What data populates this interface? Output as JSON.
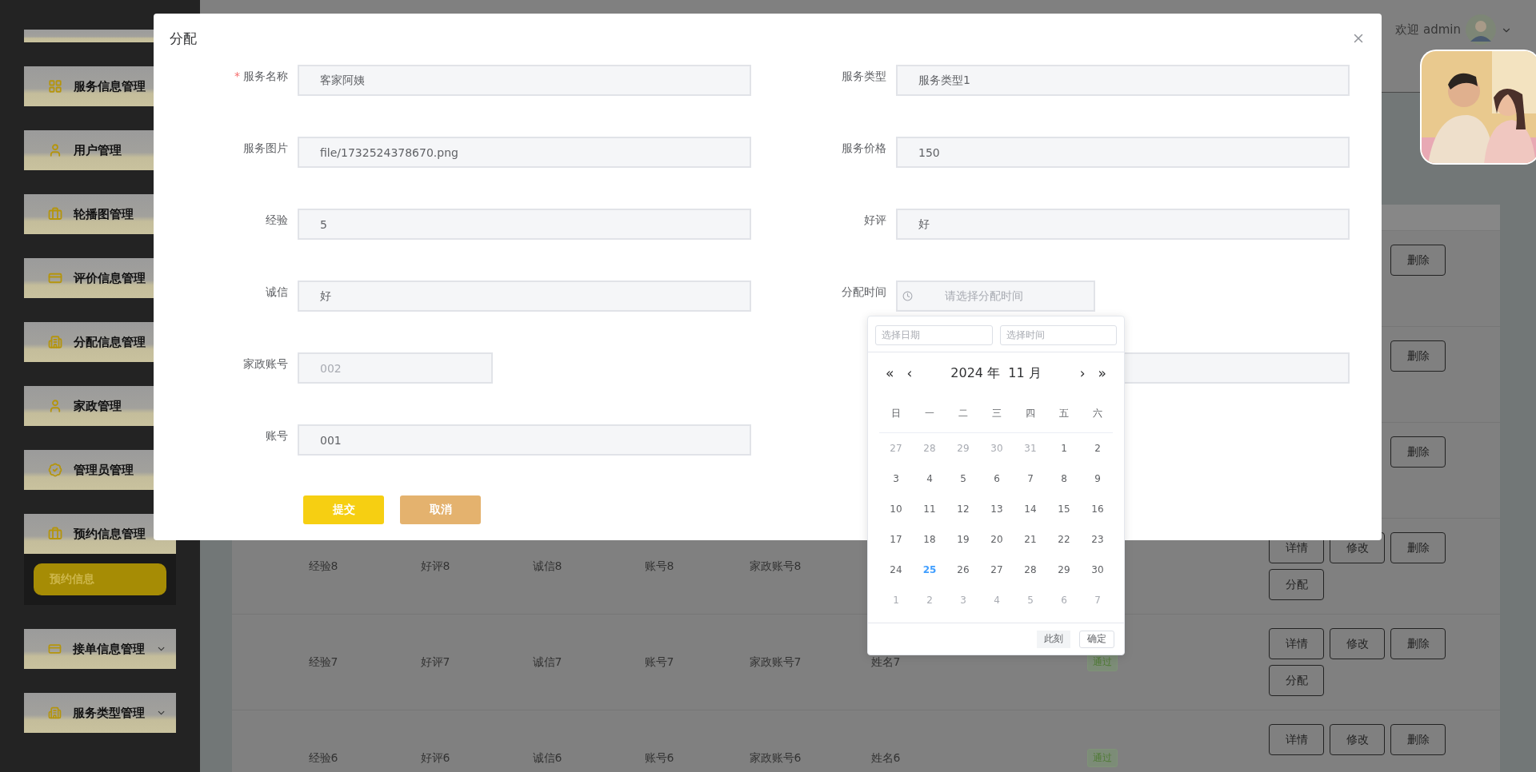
{
  "sidebar": {
    "items": [
      {
        "kind": "stub"
      },
      {
        "label": "服务信息管理",
        "kind": "page"
      },
      {
        "label": "用户管理",
        "kind": "page"
      },
      {
        "label": "轮播图管理",
        "kind": "page"
      },
      {
        "label": "评价信息管理",
        "kind": "page"
      },
      {
        "label": "分配信息管理",
        "kind": "page"
      },
      {
        "label": "家政管理",
        "kind": "page"
      },
      {
        "label": "管理员管理",
        "kind": "page"
      },
      {
        "label": "预约信息管理",
        "kind": "open_menu",
        "children": [
          {
            "label": "预约信息",
            "selected": true
          }
        ]
      },
      {
        "label": "接单信息管理",
        "kind": "menu"
      },
      {
        "label": "服务类型管理",
        "kind": "menu"
      }
    ]
  },
  "header": {
    "welcome": "欢迎 admin"
  },
  "table": {
    "rows": [
      {
        "actions": [
          {
            "label": "删除",
            "kind": "delete"
          }
        ]
      },
      {
        "actions": [
          {
            "label": "删除",
            "kind": "delete"
          }
        ]
      },
      {
        "actions": [
          {
            "label": "删除",
            "kind": "delete"
          }
        ]
      },
      {
        "cells": [
          "经验8",
          "好评8",
          "诚信8",
          "账号8",
          "家政账号8"
        ],
        "actions": [
          {
            "label": "详情",
            "kind": "details"
          },
          {
            "label": "修改",
            "kind": "edit"
          },
          {
            "label": "删除",
            "kind": "delete"
          },
          {
            "label": "分配",
            "kind": "assign"
          }
        ]
      },
      {
        "cells": [
          "经验7",
          "好评7",
          "诚信7",
          "账号7",
          "家政账号7",
          "姓名7"
        ],
        "status": "通过",
        "actions": [
          {
            "label": "详情",
            "kind": "details"
          },
          {
            "label": "修改",
            "kind": "edit"
          },
          {
            "label": "删除",
            "kind": "delete"
          },
          {
            "label": "分配",
            "kind": "assign"
          }
        ]
      },
      {
        "cells": [
          "经验6",
          "好评6",
          "诚信6",
          "账号6",
          "家政账号6",
          "姓名6"
        ],
        "status": "通过",
        "actions": [
          {
            "label": "详情",
            "kind": "details"
          },
          {
            "label": "修改",
            "kind": "edit"
          },
          {
            "label": "删除",
            "kind": "delete"
          }
        ]
      }
    ]
  },
  "dialog": {
    "title": "分配",
    "fields": [
      {
        "kind": "text",
        "label": "服务名称",
        "mark": "*",
        "value": "客家阿姨",
        "disabled": false
      },
      {
        "kind": "text",
        "label": "服务类型",
        "value": "服务类型1",
        "disabled": false
      },
      {
        "kind": "text",
        "label": "服务图片",
        "value": "file/1732524378670.png",
        "disabled": false
      },
      {
        "kind": "text",
        "label": "服务价格",
        "value": "150",
        "disabled": false
      },
      {
        "kind": "text",
        "label": "经验",
        "value": "5",
        "disabled": false
      },
      {
        "kind": "text",
        "label": "好评",
        "value": "好",
        "disabled": false
      },
      {
        "kind": "text",
        "label": "诚信",
        "value": "好",
        "disabled": false
      },
      {
        "kind": "datetime",
        "label": "分配时间",
        "placeholder": "请选择分配时间"
      },
      {
        "kind": "select",
        "label": "家政账号",
        "value": "002",
        "disabled": true
      },
      {
        "kind": "text"
      },
      {
        "kind": "text",
        "label": "账号",
        "value": "001",
        "disabled": false
      }
    ],
    "buttons": [
      {
        "label": "提交",
        "kind": "primary"
      },
      {
        "label": "取消",
        "kind": "cancel"
      }
    ]
  },
  "date_picker": {
    "date_placeholder": "选择日期",
    "time_placeholder": "选择时间",
    "prev_year": "«",
    "prev_month": "‹",
    "title": "2024 年  11 月",
    "next_month": "›",
    "next_year": "»",
    "weekdays": [
      "日",
      "一",
      "二",
      "三",
      "四",
      "五",
      "六"
    ],
    "weeks": [
      [
        {
          "label": "27",
          "kind": "other"
        },
        {
          "label": "28",
          "kind": "other"
        },
        {
          "label": "29",
          "kind": "other"
        },
        {
          "label": "30",
          "kind": "other"
        },
        {
          "label": "31",
          "kind": "other"
        },
        {
          "label": "1",
          "kind": "current"
        },
        {
          "label": "2",
          "kind": "current"
        }
      ],
      [
        {
          "label": "3",
          "kind": "current"
        },
        {
          "label": "4",
          "kind": "current"
        },
        {
          "label": "5",
          "kind": "current"
        },
        {
          "label": "6",
          "kind": "current"
        },
        {
          "label": "7",
          "kind": "current"
        },
        {
          "label": "8",
          "kind": "current"
        },
        {
          "label": "9",
          "kind": "current"
        }
      ],
      [
        {
          "label": "10",
          "kind": "current"
        },
        {
          "label": "11",
          "kind": "current"
        },
        {
          "label": "12",
          "kind": "current"
        },
        {
          "label": "13",
          "kind": "current"
        },
        {
          "label": "14",
          "kind": "current"
        },
        {
          "label": "15",
          "kind": "current"
        },
        {
          "label": "16",
          "kind": "current"
        }
      ],
      [
        {
          "label": "17",
          "kind": "current"
        },
        {
          "label": "18",
          "kind": "current"
        },
        {
          "label": "19",
          "kind": "current"
        },
        {
          "label": "20",
          "kind": "current"
        },
        {
          "label": "21",
          "kind": "current"
        },
        {
          "label": "22",
          "kind": "current"
        },
        {
          "label": "23",
          "kind": "current"
        }
      ],
      [
        {
          "label": "24",
          "kind": "current"
        },
        {
          "label": "25",
          "kind": "today"
        },
        {
          "label": "26",
          "kind": "current"
        },
        {
          "label": "27",
          "kind": "current"
        },
        {
          "label": "28",
          "kind": "current"
        },
        {
          "label": "29",
          "kind": "current"
        },
        {
          "label": "30",
          "kind": "current"
        }
      ],
      [
        {
          "label": "1",
          "kind": "other"
        },
        {
          "label": "2",
          "kind": "other"
        },
        {
          "label": "3",
          "kind": "other"
        },
        {
          "label": "4",
          "kind": "other"
        },
        {
          "label": "5",
          "kind": "other"
        },
        {
          "label": "6",
          "kind": "other"
        },
        {
          "label": "7",
          "kind": "other"
        }
      ]
    ],
    "now_button": "此刻",
    "ok_button": "确定"
  }
}
